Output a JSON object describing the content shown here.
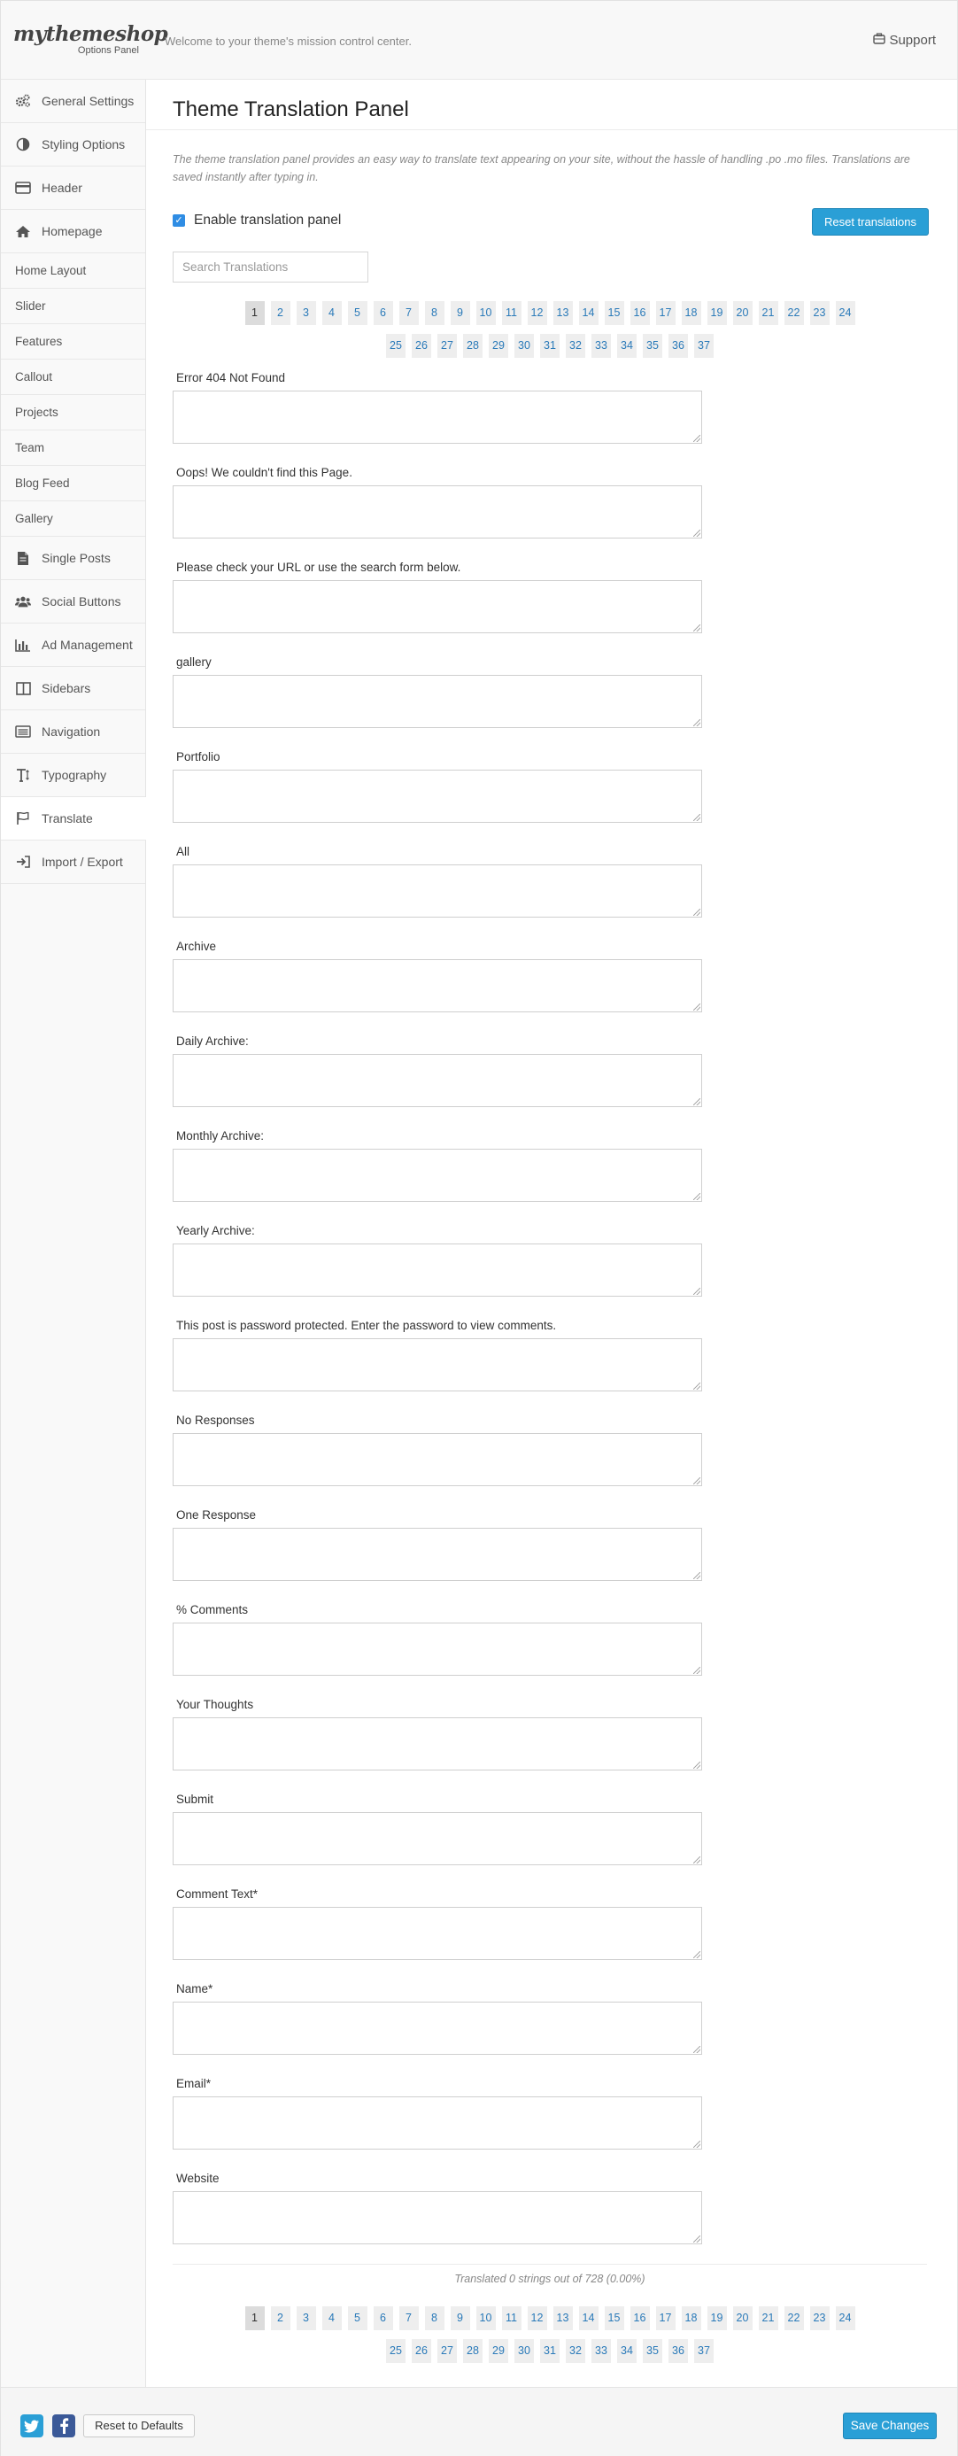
{
  "header": {
    "logo_brand": "mythemeshop",
    "logo_sub": "Options Panel",
    "tagline": "Welcome to your theme's mission control center.",
    "support_label": "Support",
    "support_icon": "briefcase-icon"
  },
  "sidebar": {
    "items": [
      {
        "label": "General Settings",
        "icon": "cogs-icon"
      },
      {
        "label": "Styling Options",
        "icon": "contrast-icon"
      },
      {
        "label": "Header",
        "icon": "credit-card-icon"
      },
      {
        "label": "Homepage",
        "icon": "home-icon"
      },
      {
        "label": "Home Layout",
        "icon": ""
      },
      {
        "label": "Slider",
        "icon": ""
      },
      {
        "label": "Features",
        "icon": ""
      },
      {
        "label": "Callout",
        "icon": ""
      },
      {
        "label": "Projects",
        "icon": ""
      },
      {
        "label": "Team",
        "icon": ""
      },
      {
        "label": "Blog Feed",
        "icon": ""
      },
      {
        "label": "Gallery",
        "icon": ""
      },
      {
        "label": "Single Posts",
        "icon": "document-icon"
      },
      {
        "label": "Social Buttons",
        "icon": "users-icon"
      },
      {
        "label": "Ad Management",
        "icon": "bar-chart-icon"
      },
      {
        "label": "Sidebars",
        "icon": "columns-icon"
      },
      {
        "label": "Navigation",
        "icon": "list-icon"
      },
      {
        "label": "Typography",
        "icon": "text-height-icon"
      },
      {
        "label": "Translate",
        "icon": "flag-icon"
      },
      {
        "label": "Import / Export",
        "icon": "sign-in-icon"
      }
    ],
    "active": "Translate"
  },
  "main": {
    "title": "Theme Translation Panel",
    "description": "The theme translation panel provides an easy way to translate text appearing on your site, without the hassle of handling .po .mo files. Translations are saved instantly after typing in.",
    "enable_label": "Enable translation panel",
    "enable_checked": true,
    "reset_button": "Reset translations",
    "search_placeholder": "Search Translations",
    "pages_row1": [
      "1",
      "2",
      "3",
      "4",
      "5",
      "6",
      "7",
      "8",
      "9",
      "10",
      "11",
      "12",
      "13",
      "14",
      "15",
      "16",
      "17",
      "18",
      "19",
      "20",
      "21",
      "22",
      "23",
      "24"
    ],
    "pages_row2": [
      "25",
      "26",
      "27",
      "28",
      "29",
      "30",
      "31",
      "32",
      "33",
      "34",
      "35",
      "36",
      "37"
    ],
    "current_page": "1",
    "fields": [
      "Error 404 Not Found",
      "Oops! We couldn't find this Page.",
      "Please check your URL or use the search form below.",
      "gallery",
      "Portfolio",
      "All",
      "Archive",
      "Daily Archive:",
      "Monthly Archive:",
      "Yearly Archive:",
      "This post is password protected. Enter the password to view comments.",
      "No Responses",
      "One Response",
      "% Comments",
      "Your Thoughts",
      "Submit",
      "Comment Text*",
      "Name*",
      "Email*",
      "Website"
    ],
    "summary": "Translated 0 strings out of 728 (0.00%)"
  },
  "footer": {
    "twitter_icon": "twitter-icon",
    "facebook_icon": "facebook-icon",
    "reset_defaults": "Reset to Defaults",
    "save_changes": "Save Changes"
  },
  "colors": {
    "accent": "#2a9fd6",
    "link": "#2a7ab9",
    "facebook": "#3b5998"
  }
}
